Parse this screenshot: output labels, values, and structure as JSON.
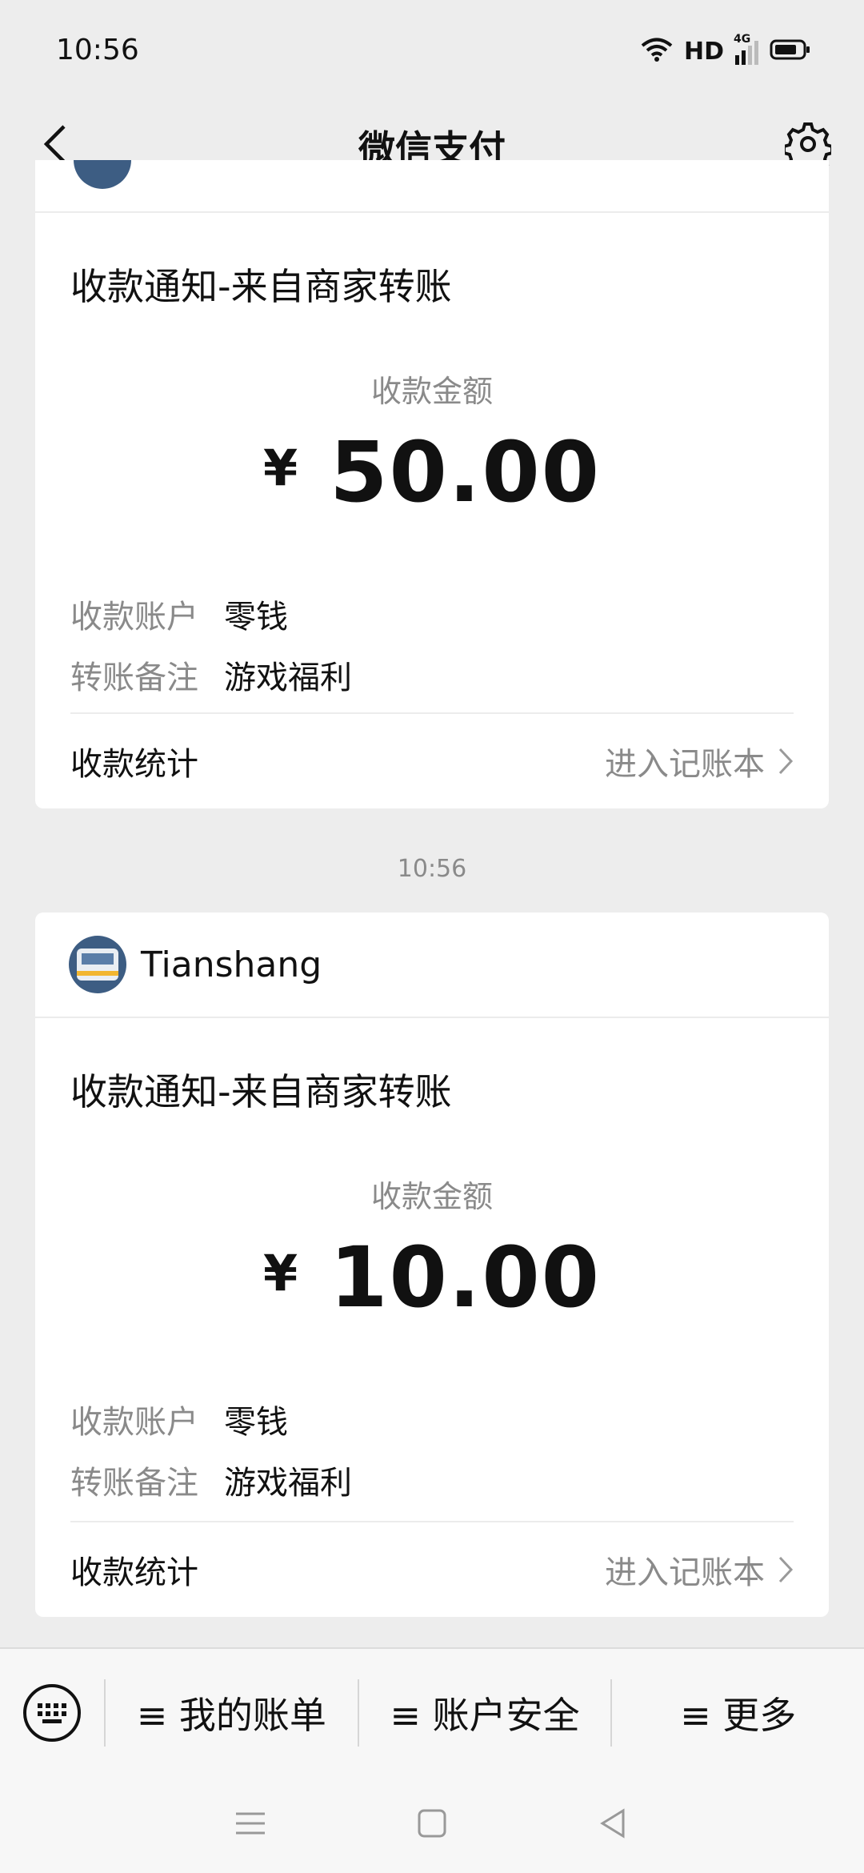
{
  "status": {
    "time": "10:56",
    "hd": "HD",
    "network": "4G"
  },
  "nav": {
    "title": "微信支付"
  },
  "card1": {
    "notice_title": "收款通知-来自商家转账",
    "amount_label": "收款金额",
    "currency": "¥",
    "amount": "50.00",
    "rows": [
      {
        "key": "收款账户",
        "value": "零钱"
      },
      {
        "key": "转账备注",
        "value": "游戏福利"
      }
    ],
    "stat_label": "收款统计",
    "stat_link": "进入记账本"
  },
  "time_separator": "10:56",
  "card2": {
    "sender": "Tianshang",
    "notice_title": "收款通知-来自商家转账",
    "amount_label": "收款金额",
    "currency": "¥",
    "amount": "10.00",
    "rows": [
      {
        "key": "收款账户",
        "value": "零钱"
      },
      {
        "key": "转账备注",
        "value": "游戏福利"
      }
    ],
    "stat_label": "收款统计",
    "stat_link": "进入记账本"
  },
  "bottom_menu": {
    "items": [
      "≡ 我的账单",
      "≡ 账户安全",
      "≡ 更多"
    ]
  },
  "colors": {
    "background": "#ededed",
    "card": "#ffffff",
    "secondary_text": "#8a8a8a"
  }
}
